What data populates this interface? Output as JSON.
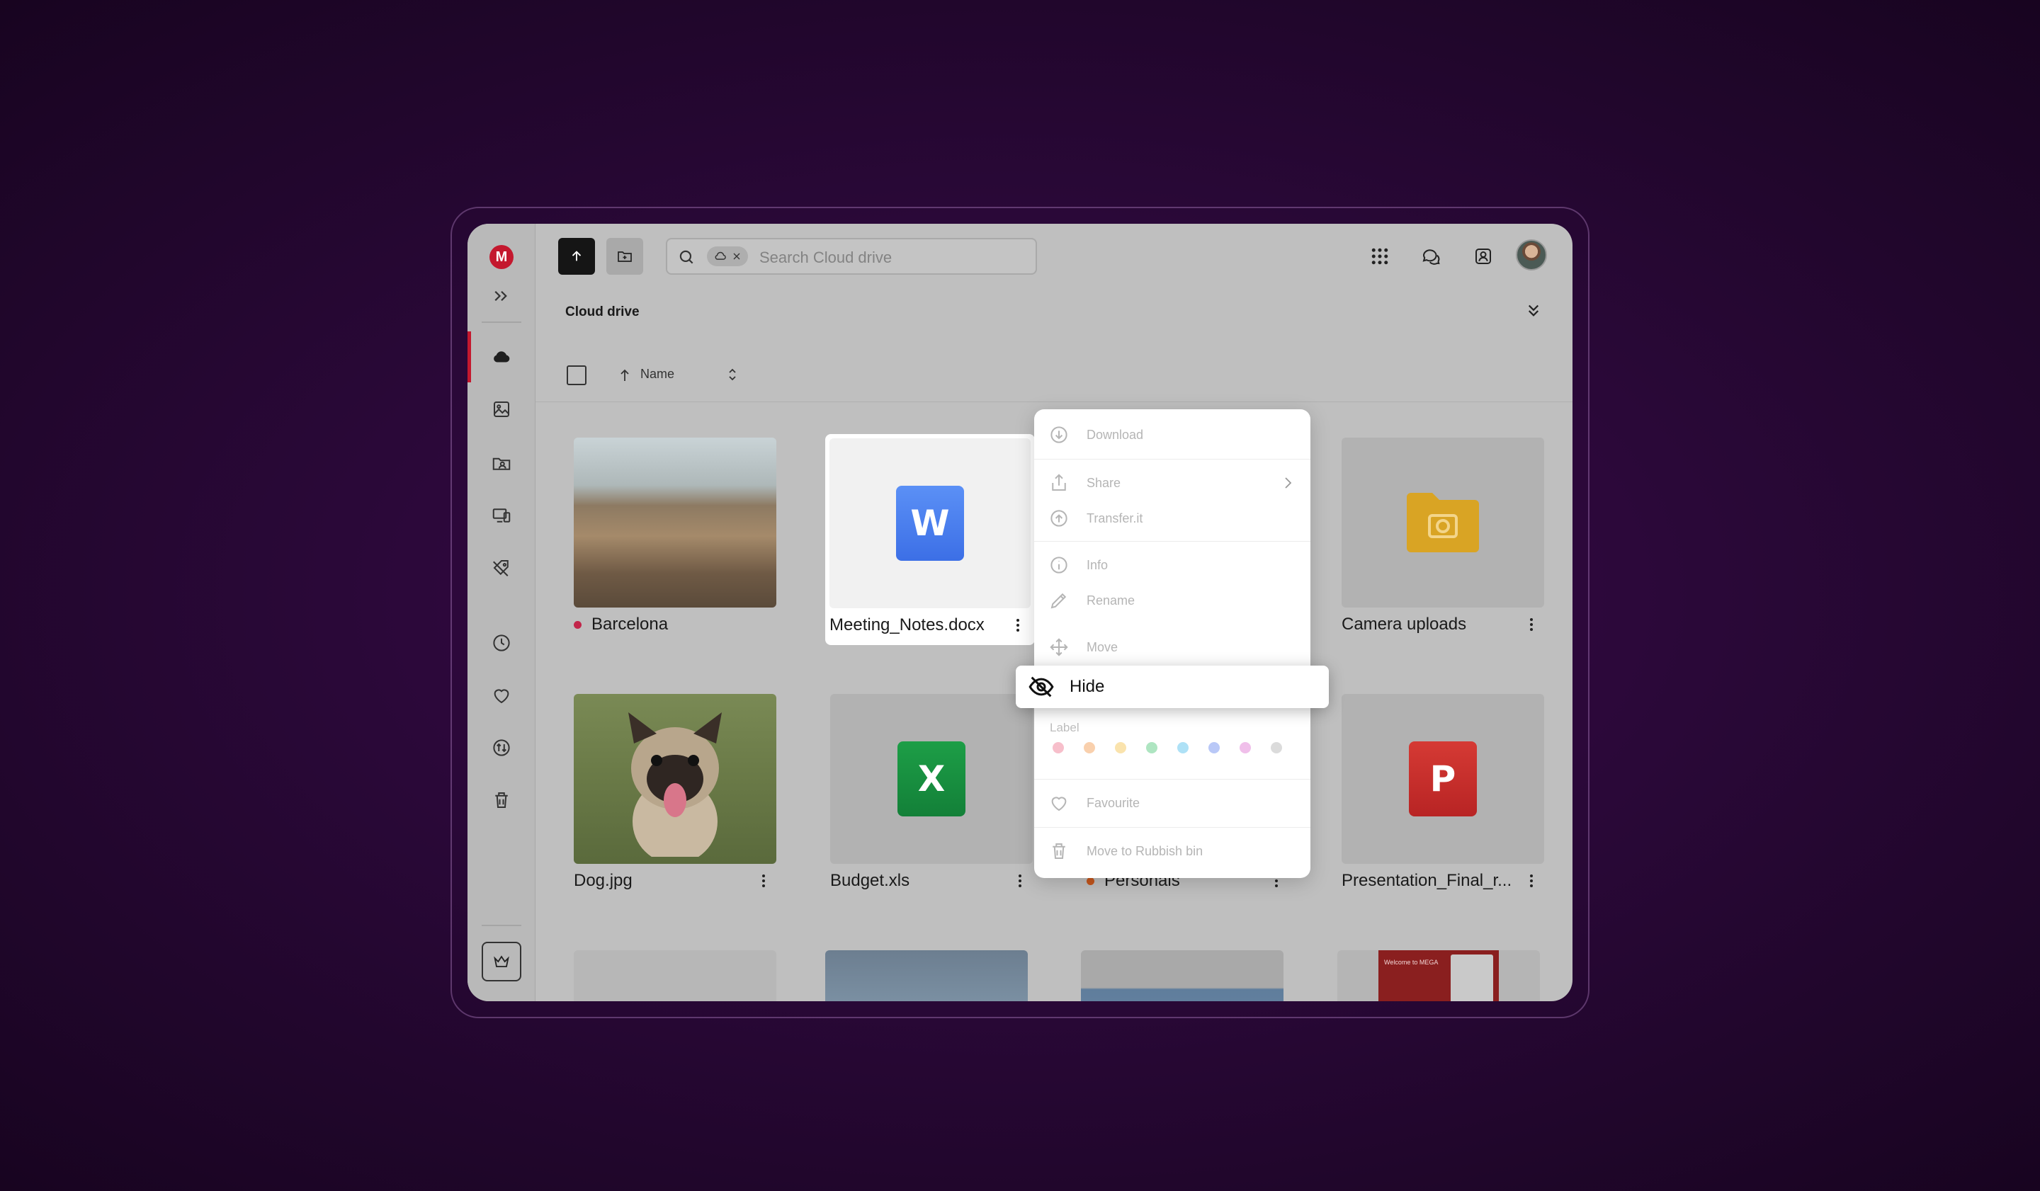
{
  "search": {
    "placeholder": "Search Cloud drive"
  },
  "page": {
    "title": "Cloud drive"
  },
  "list_header": {
    "name_label": "Name"
  },
  "files": [
    {
      "name": "Barcelona",
      "label_color": "#c2264a"
    },
    {
      "name": "Meeting_Notes.docx",
      "badge": "W",
      "badge_color": "#4f82f0"
    },
    {
      "name": "Camera uploads"
    },
    {
      "name": "Dog.jpg"
    },
    {
      "name": "Budget.xls",
      "badge": "X",
      "badge_color": "#17913f"
    },
    {
      "name": "Personals",
      "label_color": "#c4561c"
    },
    {
      "name": "Presentation_Final_r...",
      "badge": "P",
      "badge_color": "#cc2a2a"
    }
  ],
  "context_menu": {
    "download": "Download",
    "share": "Share",
    "transfer": "Transfer.it",
    "info": "Info",
    "rename": "Rename",
    "move": "Move",
    "hide": "Hide",
    "label_heading": "Label",
    "label_colors": [
      "#f08aa0",
      "#f4a96a",
      "#f5cc6a",
      "#6ccf8e",
      "#6cc9ee",
      "#7f9af0",
      "#e38ad8",
      "#bdbdbd"
    ],
    "favourite": "Favourite",
    "rubbish": "Move to Rubbish bin"
  },
  "preview": {
    "welcome_text": "Welcome to MEGA"
  },
  "colors": {
    "brand": "#c4182e",
    "accent_dark": "#151515"
  }
}
